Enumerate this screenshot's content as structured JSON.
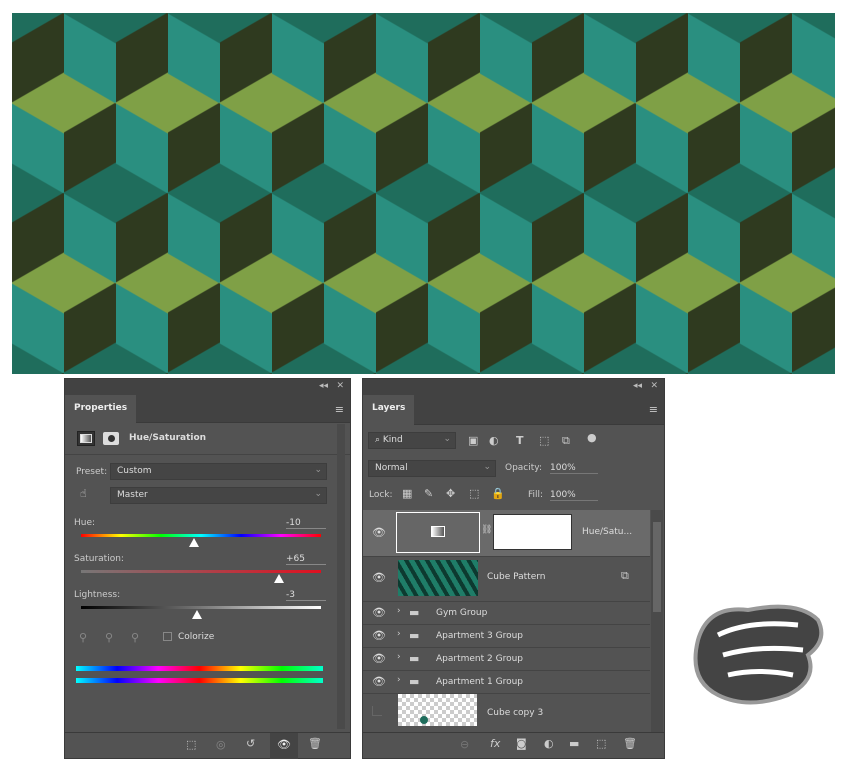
{
  "canvas": {
    "description_icon": "cube-pattern-image"
  },
  "properties": {
    "tab": "Properties",
    "title": "Hue/Saturation",
    "preset_label": "Preset:",
    "preset_value": "Custom",
    "channel_value": "Master",
    "hue_label": "Hue:",
    "hue_value": "-10",
    "hue": -10,
    "saturation_label": "Saturation:",
    "saturation_value": "+65",
    "saturation": 65,
    "lightness_label": "Lightness:",
    "lightness_value": "-3",
    "lightness": -3,
    "colorize_label": "Colorize",
    "colorize_checked": false,
    "collapse": "◂◂",
    "close": "✕"
  },
  "layers": {
    "tab": "Layers",
    "filter_kind": "Kind",
    "blend_mode": "Normal",
    "opacity_label": "Opacity:",
    "opacity_value": "100%",
    "lock_label": "Lock:",
    "fill_label": "Fill:",
    "fill_value": "100%",
    "items": [
      {
        "name": "Hue/Satu...",
        "visible": true,
        "type": "adjustment",
        "selected": true
      },
      {
        "name": "Cube Pattern",
        "visible": true,
        "type": "smart-object"
      },
      {
        "name": "Gym Group",
        "visible": true,
        "type": "group"
      },
      {
        "name": "Apartment 3 Group",
        "visible": true,
        "type": "group"
      },
      {
        "name": "Apartment 2 Group",
        "visible": true,
        "type": "group"
      },
      {
        "name": "Apartment 1 Group",
        "visible": true,
        "type": "group"
      },
      {
        "name": "Cube copy 3",
        "visible": false,
        "type": "layer"
      }
    ]
  },
  "watermark": {
    "text": "تربیت وب"
  }
}
